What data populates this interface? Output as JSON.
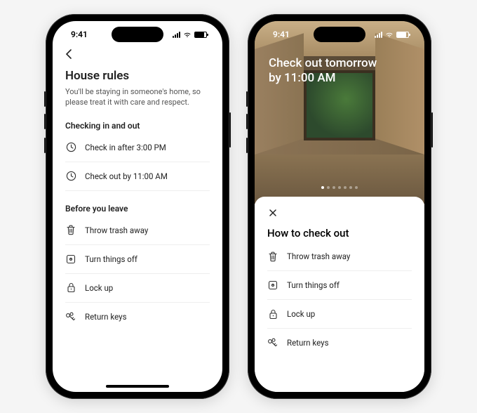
{
  "status": {
    "time": "9:41"
  },
  "left": {
    "title": "House rules",
    "subtitle": "You'll be staying in someone's home, so please treat it with care and respect.",
    "section1_title": "Checking in and out",
    "checkin_label": "Check in after 3:00 PM",
    "checkout_label": "Check out by 11:00 AM",
    "section2_title": "Before you leave",
    "item1": "Throw trash away",
    "item2": "Turn things off",
    "item3": "Lock up",
    "item4": "Return keys"
  },
  "right": {
    "hero_line1": "Check out tomorrow",
    "hero_line2": "by 11:00 AM",
    "sheet_title": "How to check out",
    "item1": "Throw trash away",
    "item2": "Turn things off",
    "item3": "Lock up",
    "item4": "Return keys"
  }
}
